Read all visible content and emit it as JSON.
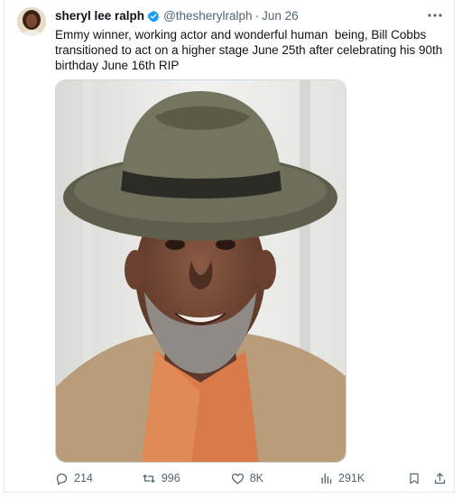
{
  "tweet": {
    "author_name": "sheryl lee ralph",
    "handle": "@thesherylralph",
    "separator": "·",
    "date": "Jun 26",
    "text": "Emmy winner, working actor and wonderful human  being, Bill Cobbs transitioned to act on a higher stage June 25th after celebrating his 90th birthday June 16th RIP",
    "verified_color": "#1d9bf0"
  },
  "actions": {
    "replies": "214",
    "reposts": "996",
    "likes": "8K",
    "views": "291K"
  },
  "icons": {
    "verified": "verified-badge-icon",
    "more": "more-icon",
    "reply": "reply-icon",
    "repost": "repost-icon",
    "like": "heart-icon",
    "views": "views-icon",
    "bookmark": "bookmark-icon",
    "share": "share-icon"
  }
}
